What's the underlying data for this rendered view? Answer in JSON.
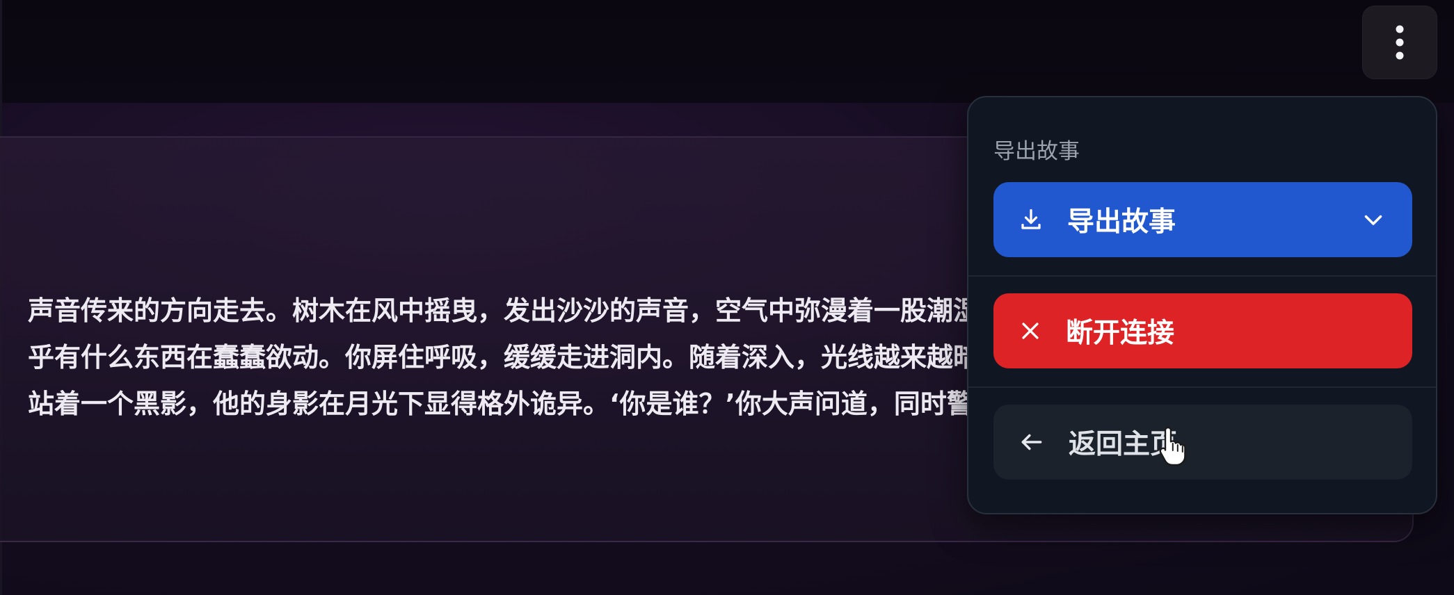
{
  "header": {
    "more_icon": "more-vertical-icon"
  },
  "story": {
    "lines": [
      "声音传来的方向走去。树木在风中摇曳，发出沙沙的声音，空气中弥漫着一股潮湿的气息。你",
      "乎有什么东西在蠢蠢欲动。你屏住呼吸，缓缓走进洞内。随着深入，光线越来越暗，你的心跳",
      "站着一个黑影，他的身影在月光下显得格外诡异。‘你是谁？’你大声问道，同时警惕地观察着"
    ]
  },
  "menu": {
    "section_label": "导出故事",
    "export_label": "导出故事",
    "export_icon": "download-icon",
    "export_chevron": "chevron-down-icon",
    "disconnect_label": "断开连接",
    "disconnect_icon": "close-icon",
    "home_label": "返回主页",
    "home_icon": "arrow-left-icon"
  },
  "colors": {
    "export_bg": "#2157cf",
    "disconnect_bg": "#dd2326",
    "home_bg": "#1b222c",
    "panel_bg": "#111722"
  }
}
